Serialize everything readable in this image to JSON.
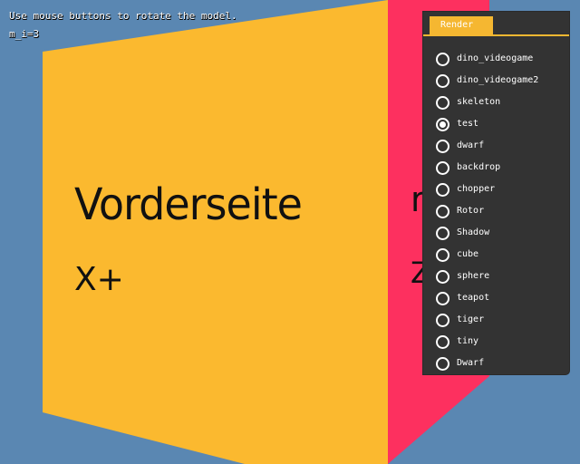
{
  "overlay": {
    "hint": "Use mouse buttons to rotate the model.",
    "counter": "m_i=3"
  },
  "scene": {
    "background_color": "#5a87b2",
    "front_face_color": "#fbb92f",
    "side_face_color": "#fd305f",
    "front_face": {
      "title": "Vorderseite",
      "axis": "X+"
    },
    "side_face": {
      "title": "re",
      "axis": "Z-"
    }
  },
  "panel": {
    "tab_label": "Render",
    "accent_color": "#f5b731",
    "selected": "test",
    "items": [
      {
        "label": "dino_videogame",
        "checked": false
      },
      {
        "label": "dino_videogame2",
        "checked": false
      },
      {
        "label": "skeleton",
        "checked": false
      },
      {
        "label": "test",
        "checked": true
      },
      {
        "label": "dwarf",
        "checked": false
      },
      {
        "label": "backdrop",
        "checked": false
      },
      {
        "label": "chopper",
        "checked": false
      },
      {
        "label": "Rotor",
        "checked": false
      },
      {
        "label": "Shadow",
        "checked": false
      },
      {
        "label": "cube",
        "checked": false
      },
      {
        "label": "sphere",
        "checked": false
      },
      {
        "label": "teapot",
        "checked": false
      },
      {
        "label": "tiger",
        "checked": false
      },
      {
        "label": "tiny",
        "checked": false
      },
      {
        "label": "Dwarf",
        "checked": false
      }
    ]
  }
}
